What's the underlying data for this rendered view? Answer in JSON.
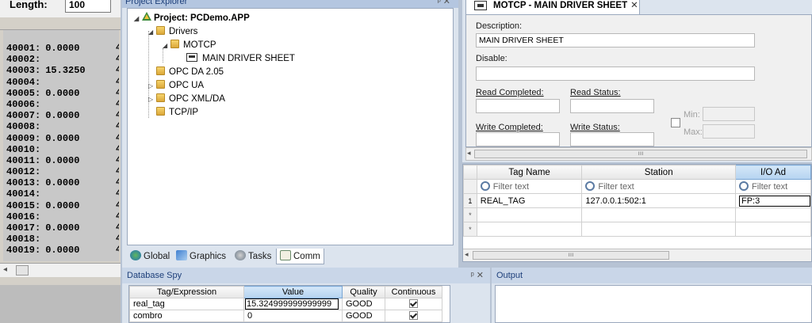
{
  "modbus_panel": {
    "length_label": "Length:",
    "length_value": "100",
    "registers": [
      {
        "addr": "40001:",
        "value": "0.0000"
      },
      {
        "addr": "40002:",
        "value": ""
      },
      {
        "addr": "40003:",
        "value": "15.3250"
      },
      {
        "addr": "40004:",
        "value": ""
      },
      {
        "addr": "40005:",
        "value": "0.0000"
      },
      {
        "addr": "40006:",
        "value": ""
      },
      {
        "addr": "40007:",
        "value": "0.0000"
      },
      {
        "addr": "40008:",
        "value": ""
      },
      {
        "addr": "40009:",
        "value": "0.0000"
      },
      {
        "addr": "40010:",
        "value": ""
      },
      {
        "addr": "40011:",
        "value": "0.0000"
      },
      {
        "addr": "40012:",
        "value": ""
      },
      {
        "addr": "40013:",
        "value": "0.0000"
      },
      {
        "addr": "40014:",
        "value": ""
      },
      {
        "addr": "40015:",
        "value": "0.0000"
      },
      {
        "addr": "40016:",
        "value": ""
      },
      {
        "addr": "40017:",
        "value": "0.0000"
      },
      {
        "addr": "40018:",
        "value": ""
      },
      {
        "addr": "40019:",
        "value": "0.0000"
      }
    ]
  },
  "project_explorer": {
    "title": "Project Explorer",
    "pin": "ᵖ",
    "close": "✕",
    "tree": {
      "project": "Project: PCDemo.APP",
      "drivers": "Drivers",
      "motcp": "MOTCP",
      "sheet": "MAIN DRIVER SHEET",
      "opc_da": "OPC DA 2.05",
      "opc_ua": "OPC UA",
      "opc_xml": "OPC XML/DA",
      "tcpip": "TCP/IP"
    },
    "tabs": [
      "Global",
      "Graphics",
      "Tasks",
      "Comm"
    ]
  },
  "driver_sheet": {
    "tab_title": "MOTCP - MAIN DRIVER SHEET",
    "tab_close": "✕",
    "description_label": "Description:",
    "description_value": "MAIN DRIVER SHEET",
    "disable_label": "Disable:",
    "read_completed_label": "Read Completed:",
    "read_status_label": "Read Status:",
    "write_completed_label": "Write Completed:",
    "write_status_label": "Write Status:",
    "min_label": "Min:",
    "max_label": "Max:"
  },
  "tag_grid": {
    "columns": [
      "Tag Name",
      "Station",
      "I/O Ad"
    ],
    "filter_placeholder": "Filter text",
    "rows": [
      {
        "num": "1",
        "tag": "REAL_TAG",
        "station": "127.0.0.1:502:1",
        "io": "FP:3"
      },
      {
        "num": "*",
        "tag": "",
        "station": "",
        "io": ""
      },
      {
        "num": "*",
        "tag": "",
        "station": "",
        "io": ""
      }
    ]
  },
  "database_spy": {
    "title": "Database Spy",
    "columns": [
      "Tag/Expression",
      "Value",
      "Quality",
      "Continuous"
    ],
    "rows": [
      {
        "tag": "real_tag",
        "value": "15.324999999999999",
        "quality": "GOOD",
        "continuous": true
      },
      {
        "tag": "combro",
        "value": "0",
        "quality": "GOOD",
        "continuous": true
      }
    ]
  },
  "output": {
    "title": "Output"
  },
  "colors": {
    "panel_bg": "#dce4ee",
    "title_text": "#1d3f7a",
    "selected_header": "#b5d3f0"
  }
}
